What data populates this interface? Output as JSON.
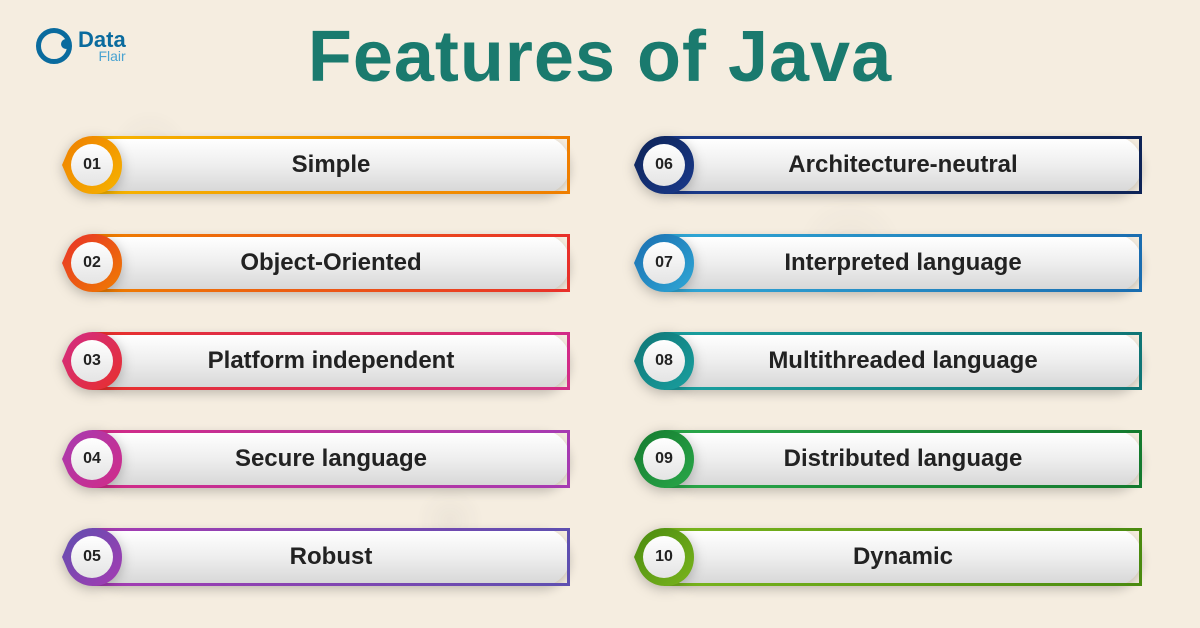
{
  "logo": {
    "line1": "Data",
    "line2": "Flair"
  },
  "title": "Features of Java",
  "features": [
    {
      "num": "01",
      "label": "Simple",
      "c1": "#f6b400",
      "c2": "#ef7e00"
    },
    {
      "num": "02",
      "label": "Object-Oriented",
      "c1": "#ef7e00",
      "c2": "#e8302a"
    },
    {
      "num": "03",
      "label": "Platform independent",
      "c1": "#e8302a",
      "c2": "#d22b87"
    },
    {
      "num": "04",
      "label": "Secure language",
      "c1": "#d22b87",
      "c2": "#a63bb2"
    },
    {
      "num": "05",
      "label": "Robust",
      "c1": "#a63bb2",
      "c2": "#5e4fb0"
    },
    {
      "num": "06",
      "label": "Architecture-neutral",
      "c1": "#1a3a8c",
      "c2": "#0d2356"
    },
    {
      "num": "07",
      "label": "Interpreted language",
      "c1": "#30a8d6",
      "c2": "#1a6db0"
    },
    {
      "num": "08",
      "label": "Multithreaded language",
      "c1": "#1aa0a0",
      "c2": "#0f7575"
    },
    {
      "num": "09",
      "label": "Distributed language",
      "c1": "#2aa84a",
      "c2": "#147a2e"
    },
    {
      "num": "10",
      "label": "Dynamic",
      "c1": "#7ab51d",
      "c2": "#4a8a0f"
    }
  ]
}
